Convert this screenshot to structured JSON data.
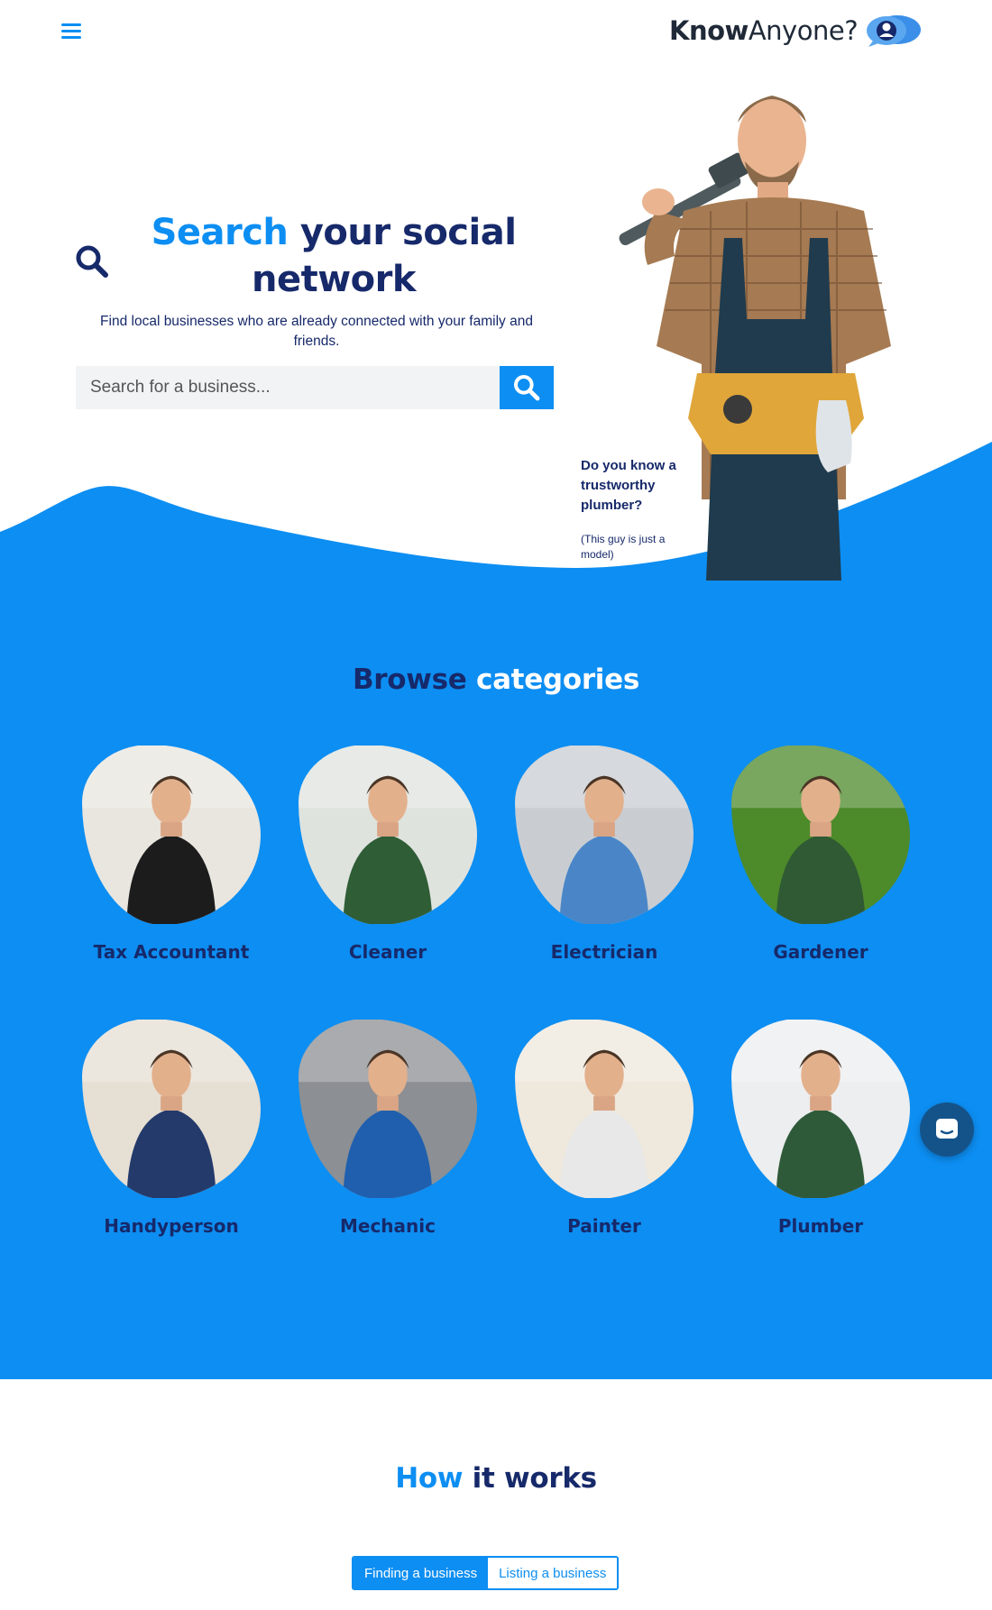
{
  "header": {
    "logo_know": "Know",
    "logo_anyone": "Anyone?"
  },
  "hero": {
    "title_accent": "Search",
    "title_rest": " your social network",
    "subtitle": "Find local businesses who are already connected with your family and friends.",
    "search_placeholder": "Search for a business...",
    "caption_question": "Do you know a trustworthy plumber?",
    "caption_note": "(This guy is just a model)"
  },
  "browse": {
    "title_dark": "Browse",
    "title_light": " categories",
    "categories": [
      {
        "label": "Tax Accountant",
        "icon": "tax-accountant-photo",
        "bg": "#e8e6df",
        "figure": "#1c1c1c"
      },
      {
        "label": "Cleaner",
        "icon": "cleaner-photo",
        "bg": "#dfe3de",
        "figure": "#2e5d36"
      },
      {
        "label": "Electrician",
        "icon": "electrician-photo",
        "bg": "#c9cdd2",
        "figure": "#4a86c7"
      },
      {
        "label": "Gardener",
        "icon": "gardener-photo",
        "bg": "#4d8a2a",
        "figure": "#2f5a34"
      },
      {
        "label": "Handyperson",
        "icon": "handyperson-photo",
        "bg": "#e6dfd3",
        "figure": "#233a6b"
      },
      {
        "label": "Mechanic",
        "icon": "mechanic-photo",
        "bg": "#8c8f93",
        "figure": "#1f5fae"
      },
      {
        "label": "Painter",
        "icon": "painter-photo",
        "bg": "#efe8dc",
        "figure": "#e8e8e8"
      },
      {
        "label": "Plumber",
        "icon": "plumber-photo",
        "bg": "#eceeef",
        "figure": "#2f5a3a"
      }
    ]
  },
  "how": {
    "title_accent": "How",
    "title_rest": " it works",
    "tabs": [
      "Finding a business",
      "Listing a business"
    ]
  },
  "colors": {
    "brand_blue": "#0d8ef2",
    "navy": "#16296a"
  }
}
